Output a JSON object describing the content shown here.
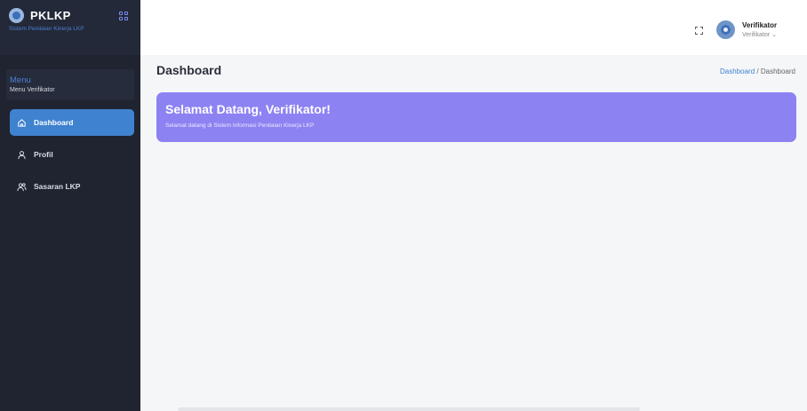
{
  "brand": {
    "name": "PKLKP",
    "subtitle": "Sistem Penilaian Kinerja LKP"
  },
  "menu": {
    "title": "Menu",
    "subtitle": "Menu Verifikator"
  },
  "sidebar": {
    "items": [
      {
        "label": "Dashboard",
        "icon": "home-icon",
        "active": true
      },
      {
        "label": "Profil",
        "icon": "user-icon",
        "active": false
      },
      {
        "label": "Sasaran LKP",
        "icon": "users-icon",
        "active": false
      }
    ]
  },
  "header": {
    "user_name": "Verifikator",
    "user_role": "Verifikator"
  },
  "page": {
    "title": "Dashboard",
    "breadcrumb": {
      "link": "Dashboard",
      "separator": "/",
      "current": "Dashboard"
    }
  },
  "banner": {
    "title": "Selamat Datang, Verifikator!",
    "text": "Selamat datang di Sistem Informasi Penilaian Kinerja LKP"
  },
  "colors": {
    "sidebar_bg": "#1f2430",
    "active_item": "#3f82cf",
    "banner_bg": "#8c82f2",
    "accent": "#4f7fd4"
  }
}
